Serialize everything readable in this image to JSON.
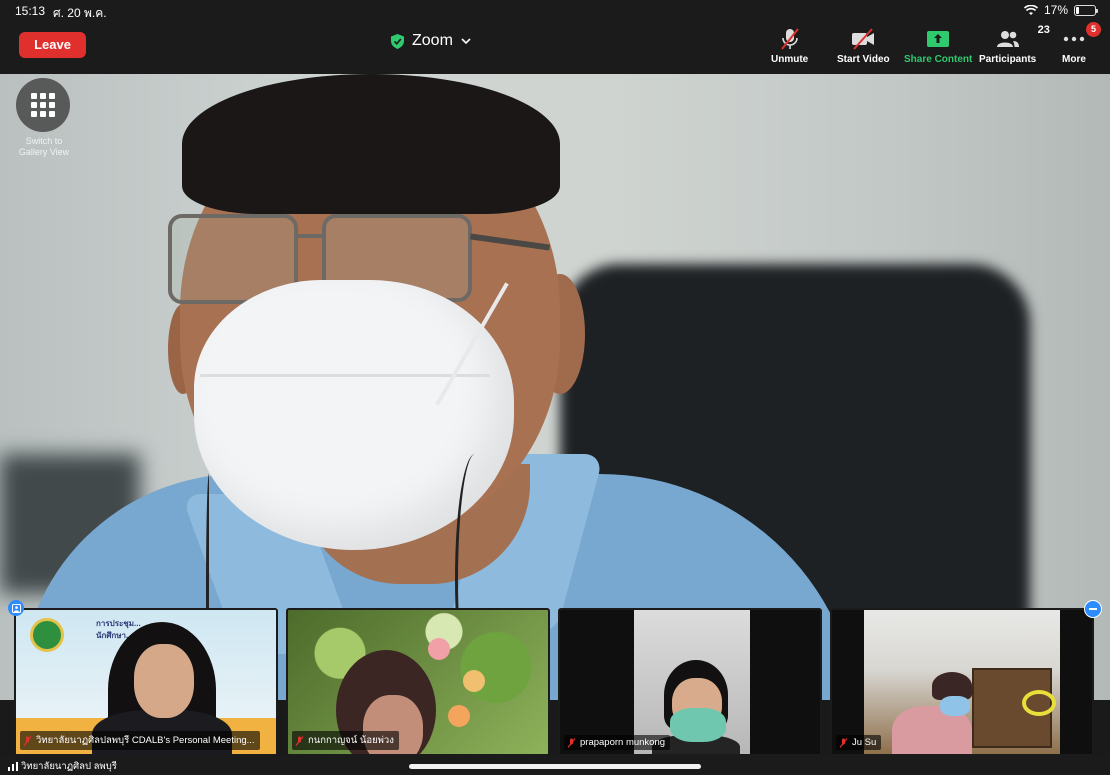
{
  "status_bar": {
    "time": "15:13",
    "date": "ศ. 20 พ.ค.",
    "battery_percent": "17%",
    "wifi_icon": "wifi-icon",
    "battery_icon": "battery-icon"
  },
  "toolbar": {
    "leave_label": "Leave",
    "app_title": "Zoom",
    "unmute_label": "Unmute",
    "start_video_label": "Start Video",
    "share_content_label": "Share Content",
    "participants_label": "Participants",
    "participants_count": "23",
    "more_label": "More",
    "more_badge": "5",
    "colors": {
      "leave": "#e0302e",
      "share": "#2fc96e",
      "badge": "#e0302e"
    }
  },
  "gallery_toggle": {
    "label_line1": "Switch to",
    "label_line2": "Gallery View"
  },
  "thumbnails": [
    {
      "name": "วิทยาลัยนาฏศิลปลพบุรี CDALB's Personal Meeting...",
      "muted": true,
      "banner_line1": "การประชุม...",
      "banner_line2": "นักศึกษา..."
    },
    {
      "name": "กนกกาญจน์ น้อยพ่วง",
      "muted": true
    },
    {
      "name": "prapaporn munkong",
      "muted": true
    },
    {
      "name": "Ju Su",
      "muted": true
    }
  ],
  "active_speaker": {
    "name": "วิทยาลัยนาฏศิลป ลพบุรี"
  }
}
